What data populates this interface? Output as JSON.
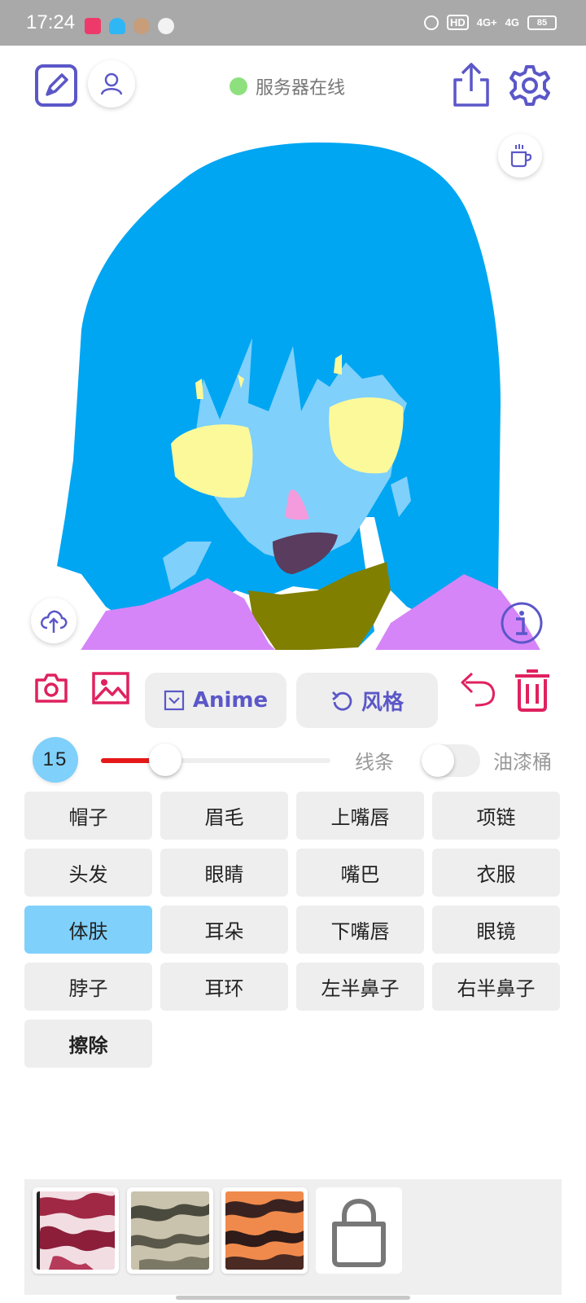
{
  "status_bar": {
    "time": "17:24",
    "hd_label": "HD",
    "net1": "4G+",
    "net2": "4G",
    "battery": "85"
  },
  "header": {
    "server_status": "服务器在线",
    "server_status_color": "#8ee07f"
  },
  "tools": {
    "anime_label": "Anime",
    "style_label": "风格"
  },
  "brush": {
    "size": "15",
    "size_fraction": 0.28,
    "line_label": "线条",
    "bucket_label": "油漆桶",
    "bucket_enabled": false
  },
  "parts": [
    {
      "label": "帽子"
    },
    {
      "label": "眉毛"
    },
    {
      "label": "上嘴唇"
    },
    {
      "label": "项链"
    },
    {
      "label": "头发"
    },
    {
      "label": "眼睛"
    },
    {
      "label": "嘴巴"
    },
    {
      "label": "衣服"
    },
    {
      "label": "体肤",
      "selected": true
    },
    {
      "label": "耳朵"
    },
    {
      "label": "下嘴唇"
    },
    {
      "label": "眼镜"
    },
    {
      "label": "脖子"
    },
    {
      "label": "耳环"
    },
    {
      "label": "左半鼻子"
    },
    {
      "label": "右半鼻子"
    },
    {
      "label": "擦除",
      "bold": true
    }
  ],
  "colors": {
    "accent": "#5b57c8",
    "danger": "#e0215f",
    "hair": "#00a6f2",
    "skin": "#7fd0fb",
    "eyes": "#fcf99a",
    "nose": "#f39bdc",
    "mouth": "#5a3c5e",
    "neck": "#807f00",
    "clothes": "#d585f8",
    "selected_part": "#7fd0fb"
  },
  "textures": [
    {
      "name": "crimson-texture"
    },
    {
      "name": "beige-texture"
    },
    {
      "name": "orange-texture"
    },
    {
      "name": "shop-bag-icon"
    }
  ]
}
